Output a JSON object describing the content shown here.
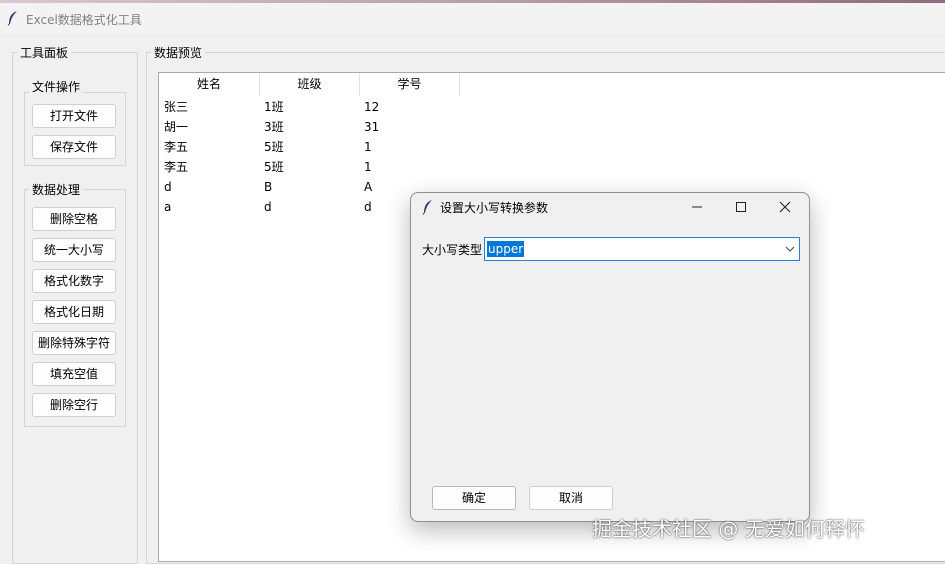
{
  "window": {
    "title": "Excel数据格式化工具"
  },
  "tool_panel": {
    "title": "工具面板",
    "file_ops": {
      "title": "文件操作",
      "buttons": [
        "打开文件",
        "保存文件"
      ]
    },
    "data_ops": {
      "title": "数据处理",
      "buttons": [
        "删除空格",
        "统一大小写",
        "格式化数字",
        "格式化日期",
        "删除特殊字符",
        "填充空值",
        "删除空行"
      ]
    }
  },
  "preview": {
    "title": "数据预览",
    "columns": [
      "姓名",
      "班级",
      "学号"
    ],
    "rows": [
      [
        "张三",
        "1班",
        "12"
      ],
      [
        "胡一",
        "3班",
        "31"
      ],
      [
        "李五",
        "5班",
        "1"
      ],
      [
        "李五",
        "5班",
        "1"
      ],
      [
        "d",
        "B",
        "A"
      ],
      [
        "a",
        "d",
        "d"
      ]
    ]
  },
  "dialog": {
    "title": "设置大小写转换参数",
    "label": "大小写类型",
    "combo_value": "upper",
    "ok": "确定",
    "cancel": "取消"
  },
  "watermark": "掘金技术社区 @ 无爱如何释怀"
}
